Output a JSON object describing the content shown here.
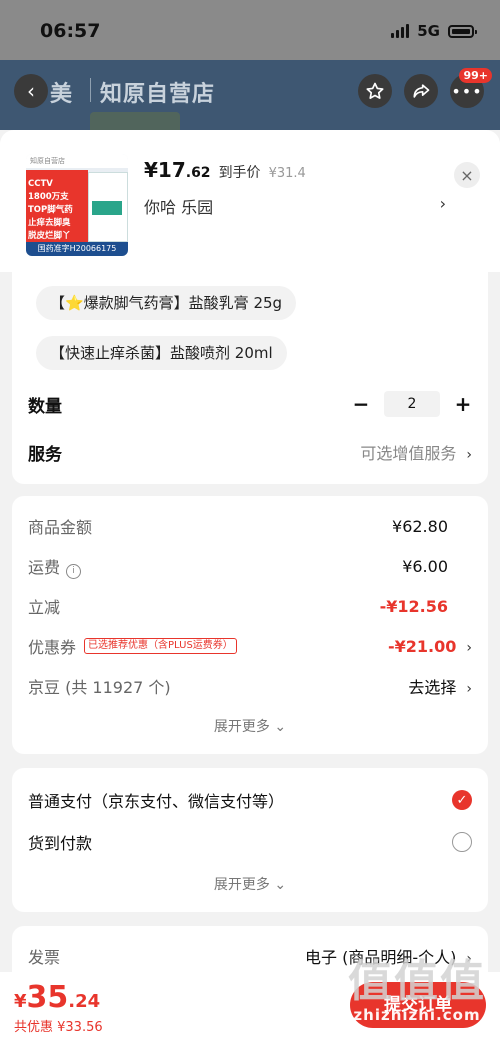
{
  "status_bar": {
    "time": "06:57",
    "network": "5G"
  },
  "store_header": {
    "brand": "美",
    "name": "知原自营店",
    "badge": "99+"
  },
  "product": {
    "thumb": {
      "top_text": "知原自营店",
      "lines": [
        "CCTV",
        "1800万支",
        "TOP脚气药",
        "止痒去脚臭",
        "脱皮烂脚丫"
      ],
      "bottom_text": "国药准字H20066175"
    },
    "price_int": "¥17",
    "price_dec": ".62",
    "price_tag": "到手价",
    "price_orig": "¥31.4",
    "variant": "你哈  乐园",
    "variant_arrow": "›",
    "close": "×"
  },
  "specs": [
    "【⭐爆款脚气药膏】盐酸乳膏 25g",
    "【快速止痒杀菌】盐酸喷剂 20ml"
  ],
  "quantity": {
    "label": "数量",
    "value": "2",
    "minus": "−",
    "plus": "+"
  },
  "service": {
    "label": "服务",
    "value": "可选增值服务",
    "arrow": "›"
  },
  "price_detail": {
    "goods_label": "商品金额",
    "goods_value": "¥62.80",
    "shipping_label": "运费",
    "shipping_info": "i",
    "shipping_value": "¥6.00",
    "discount_label": "立减",
    "discount_value": "-¥12.56",
    "coupon_label": "优惠券",
    "coupon_note": "已选推荐优惠（含PLUS运费券）",
    "coupon_value": "-¥21.00",
    "jd_label": "京豆 (共 11927 个)",
    "jd_value": "去选择",
    "expand": "展开更多 ⌄"
  },
  "payment": {
    "option1": "普通支付（京东支付、微信支付等）",
    "option2": "货到付款",
    "expand": "展开更多 ⌄"
  },
  "invoice": {
    "label": "发票",
    "value": "电子 (商品明细-个人)",
    "arrow": "›"
  },
  "bottom": {
    "yen": "¥",
    "total_int": "35",
    "total_dec": ".24",
    "save": "共优惠 ¥33.56",
    "submit": "提交订单"
  },
  "watermark": {
    "big": "值值值",
    "url": "zhizhizhi.com"
  },
  "colors": {
    "accent": "#e8352c",
    "header_bg": "#3e5772"
  }
}
